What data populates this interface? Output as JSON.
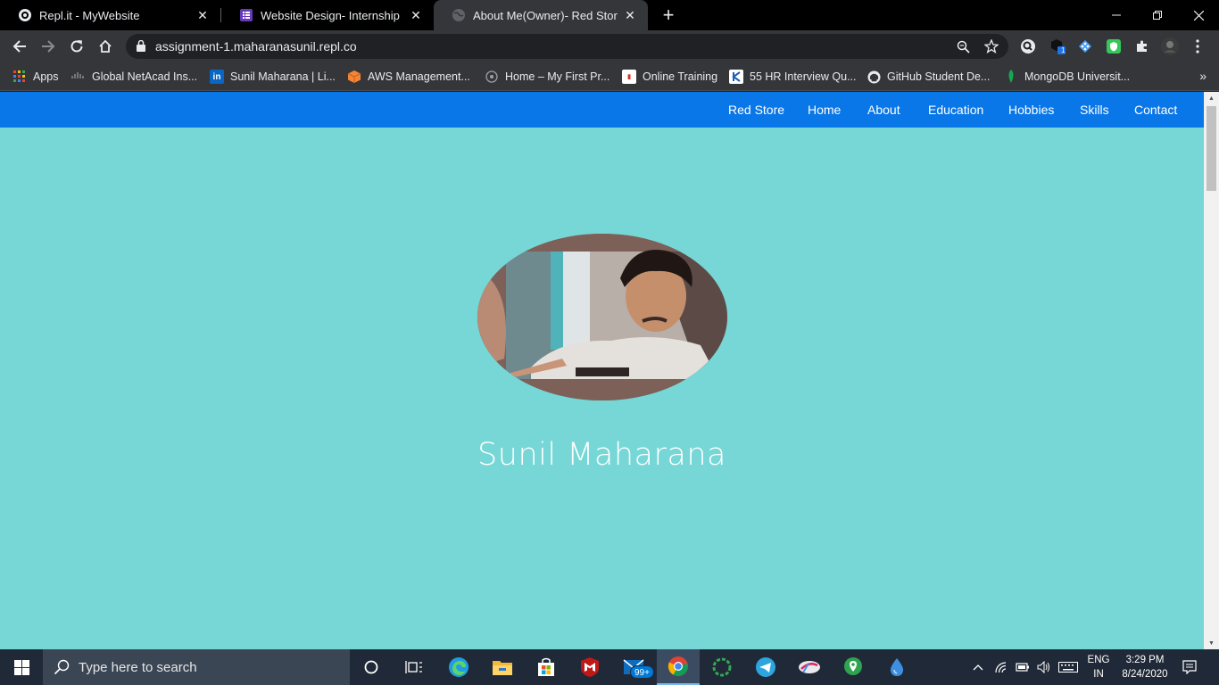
{
  "browser": {
    "tabs": [
      {
        "title": "Repl.it - MyWebsite",
        "close": "✕"
      },
      {
        "title": "Website Design- Internship Proje",
        "close": "✕"
      },
      {
        "title": "About Me(Owner)- Red Store",
        "close": "✕"
      }
    ],
    "new_tab": "+",
    "address": "assignment-1.maharanasunil.repl.co",
    "bookmarks": [
      {
        "label": "Apps"
      },
      {
        "label": "Global NetAcad Ins..."
      },
      {
        "label": "Sunil Maharana | Li..."
      },
      {
        "label": "AWS Management..."
      },
      {
        "label": "Home – My First Pr..."
      },
      {
        "label": "Online Training"
      },
      {
        "label": "55 HR Interview Qu..."
      },
      {
        "label": "GitHub Student De..."
      },
      {
        "label": "MongoDB Universit..."
      }
    ],
    "bookmarks_overflow": "»",
    "extension_badge": "1"
  },
  "page": {
    "nav": [
      {
        "label": "Red Store"
      },
      {
        "label": "Home"
      },
      {
        "label": "About"
      },
      {
        "label": "Education"
      },
      {
        "label": "Hobbies"
      },
      {
        "label": "Skills"
      },
      {
        "label": "Contact"
      }
    ],
    "name": "Sunil Maharana",
    "colors": {
      "background": "#76d7d6",
      "navbar": "#0a77e8",
      "text": "#ffffff"
    }
  },
  "taskbar": {
    "search_placeholder": "Type here to search",
    "mail_badge": "99+",
    "language": "ENG",
    "region": "IN",
    "time": "3:29 PM",
    "date": "8/24/2020"
  }
}
